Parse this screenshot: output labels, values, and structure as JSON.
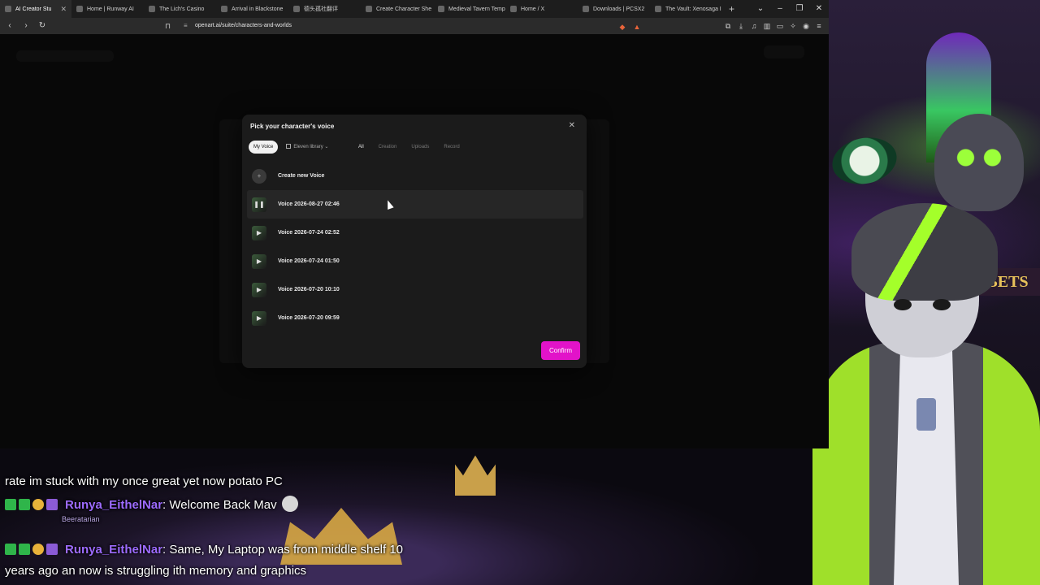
{
  "browser": {
    "tabs": [
      {
        "label": "AI Creator Stu",
        "active": true
      },
      {
        "label": "Home | Runway AI"
      },
      {
        "label": "The Lich's Casino"
      },
      {
        "label": "Arrival in Blackstone"
      },
      {
        "label": "德头孤社翻评"
      },
      {
        "label": "Create Character She"
      },
      {
        "label": "Medieval Tavern Temp"
      },
      {
        "label": "Home / X"
      },
      {
        "label": "Downloads | PCSX2"
      },
      {
        "label": "The Vault: Xenosaga I"
      }
    ],
    "url": "openart.ai/suite/characters-and-worlds",
    "window_controls": [
      "–",
      "❐",
      "✕"
    ]
  },
  "modal": {
    "title": "Pick your character's voice",
    "sources": [
      "My Voice",
      "Eleven library"
    ],
    "active_source": "My Voice",
    "filters": [
      "All",
      "Creation",
      "Uploads",
      "Record"
    ],
    "active_filter": "All",
    "create_label": "Create new Voice",
    "voices": [
      {
        "label": "Voice 2026-08-27 02:46",
        "state": "playing"
      },
      {
        "label": "Voice 2026-07-24 02:52",
        "state": "paused"
      },
      {
        "label": "Voice 2026-07-24 01:50",
        "state": "paused"
      },
      {
        "label": "Voice 2026-07-20 10:10",
        "state": "paused"
      },
      {
        "label": "Voice 2026-07-20 09:59",
        "state": "paused"
      }
    ],
    "confirm_label": "Confirm",
    "accent": "#e213c9"
  },
  "scene": {
    "sign_text": "BETS"
  },
  "chat": {
    "lines": [
      {
        "user": "",
        "text": "rate im stuck with my once great yet now potato PC"
      },
      {
        "user": "Runya_EithelNar",
        "text": ": Welcome Back Mav"
      },
      {
        "user": "",
        "sub": "Beeratarian"
      },
      {
        "user": "Runya_EithelNar",
        "text": ": Same, My Laptop was from middle shelf 10"
      },
      {
        "user": "",
        "text": "years ago an now is struggling ith memory and graphics"
      }
    ]
  }
}
